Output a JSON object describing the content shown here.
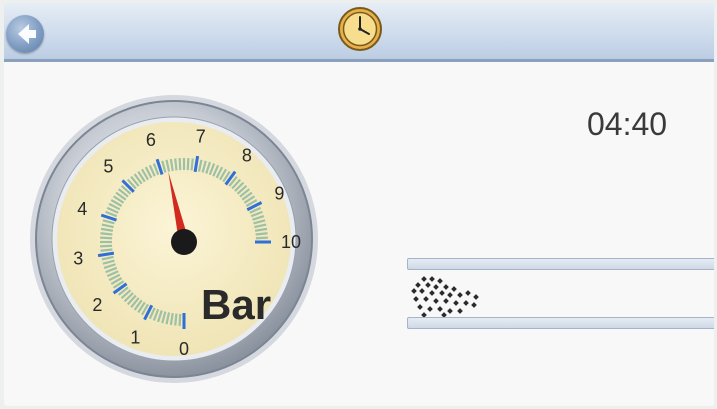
{
  "header": {
    "back_icon": "back-arrow-icon",
    "center_icon": "clock-icon"
  },
  "time": {
    "value": "04:40"
  },
  "gauge": {
    "unit": "Bar",
    "ticks": [
      "0",
      "1",
      "2",
      "3",
      "4",
      "5",
      "6",
      "7",
      "8",
      "9",
      "10"
    ],
    "min": 0,
    "max": 10,
    "needle_value": 6.2,
    "colors": {
      "face": "#f5ecc4",
      "band": "#9ec0a4",
      "tick": "#2f6fd6",
      "needle": "#d32a1f",
      "bezel": "#c9ced6"
    }
  },
  "status": {
    "pattern_icon": "dotted-pattern-icon"
  }
}
